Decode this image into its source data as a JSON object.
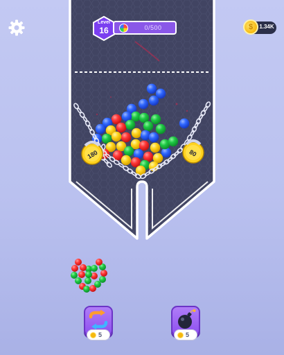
{
  "header": {
    "level_word": "Level",
    "level_number": "16",
    "progress_text": "0/500",
    "progress_fraction": 0,
    "coins": "1.34K"
  },
  "locks": [
    {
      "label": "180"
    },
    {
      "label": "80"
    }
  ],
  "boosters": [
    {
      "name": "shuffle",
      "icon": "shuffle-icon",
      "cost": "5"
    },
    {
      "name": "bomb",
      "icon": "bomb-icon",
      "cost": "5"
    }
  ],
  "colors": {
    "red": "#ff3737",
    "yellow": "#ffd41c",
    "green": "#1ec944",
    "blue": "#2f67ff",
    "level_badge": "#7b3ff0",
    "container_fill": "#424563",
    "outline": "#ffffff"
  },
  "heart_ball_colors": [
    "red",
    "red",
    "green",
    "green",
    "red",
    "green",
    "red",
    "green",
    "green",
    "red",
    "green",
    "red",
    "green",
    "red",
    "red",
    "green",
    "red",
    "green",
    "green"
  ]
}
